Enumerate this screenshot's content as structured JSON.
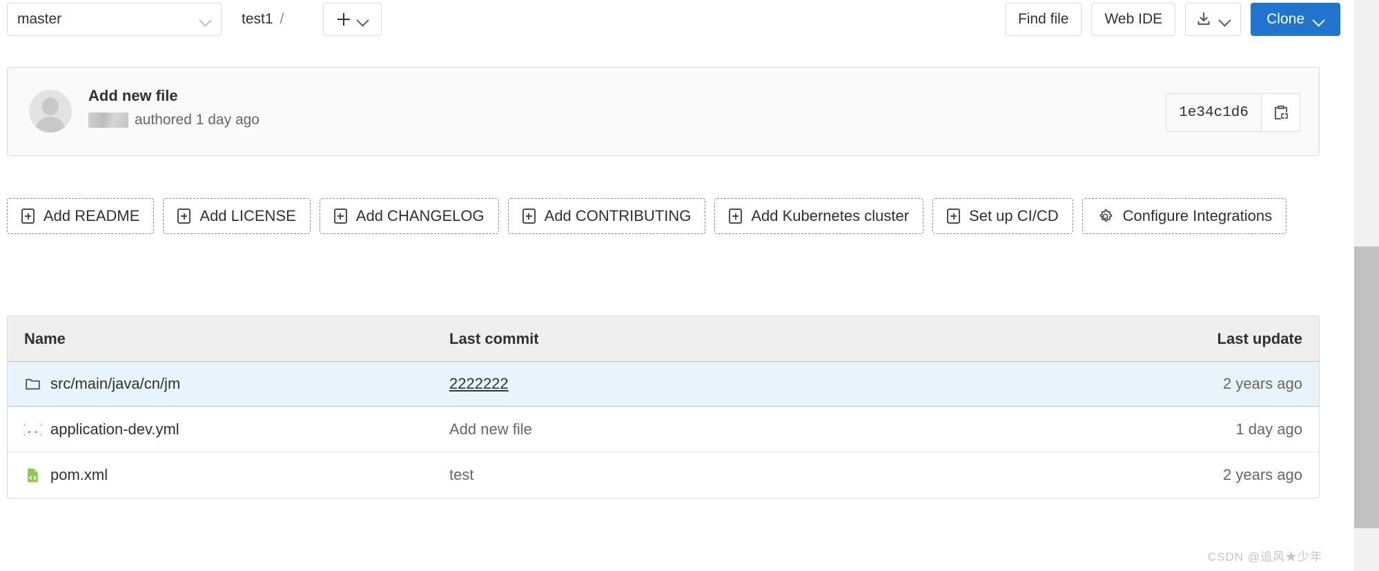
{
  "toolbar": {
    "branch": "master",
    "branch_caret_icon": "chevron-down-icon",
    "breadcrumb_project": "test1",
    "breadcrumb_separator": "/",
    "add_plus_icon": "plus-icon",
    "add_caret_icon": "chevron-down-icon",
    "find_file_label": "Find file",
    "web_ide_label": "Web IDE",
    "download_icon": "download-icon",
    "download_caret_icon": "chevron-down-icon",
    "clone_label": "Clone",
    "clone_caret_icon": "chevron-down-icon",
    "clone_color": "#1f75cb"
  },
  "commit": {
    "avatar_icon": "default-avatar-icon",
    "title": "Add new file",
    "author_redacted": "",
    "meta_suffix": "authored 1 day ago",
    "sha": "1e34c1d6",
    "copy_icon": "clipboard-copy-icon"
  },
  "quick_actions": [
    {
      "label": "Add README",
      "icon": "plus-square-icon"
    },
    {
      "label": "Add LICENSE",
      "icon": "plus-square-icon"
    },
    {
      "label": "Add CHANGELOG",
      "icon": "plus-square-icon"
    },
    {
      "label": "Add CONTRIBUTING",
      "icon": "plus-square-icon"
    },
    {
      "label": "Add Kubernetes cluster",
      "icon": "plus-square-icon"
    },
    {
      "label": "Set up CI/CD",
      "icon": "plus-square-icon"
    },
    {
      "label": "Configure Integrations",
      "icon": "gear-icon"
    }
  ],
  "file_table": {
    "columns": {
      "name": "Name",
      "last_commit": "Last commit",
      "last_update": "Last update"
    },
    "rows": [
      {
        "name": "src/main/java/cn/jm",
        "icon": "folder-icon",
        "icon_color": "#5c5c5c",
        "last_commit": "2222222",
        "commit_is_link": true,
        "last_update": "2 years ago",
        "selected": true
      },
      {
        "name": "application-dev.yml",
        "icon": "yaml-file-icon",
        "icon_color": "#f34f29",
        "last_commit": "Add new file",
        "commit_is_link": false,
        "last_update": "1 day ago",
        "selected": false
      },
      {
        "name": "pom.xml",
        "icon": "xml-file-icon",
        "icon_color": "#8cc84b",
        "last_commit": "test",
        "commit_is_link": false,
        "last_update": "2 years ago",
        "selected": false
      }
    ]
  },
  "watermark": "CSDN @追风★少年",
  "scrollbar": {
    "track_color": "#f1f1f1",
    "thumb_color": "#c1c1c1"
  }
}
